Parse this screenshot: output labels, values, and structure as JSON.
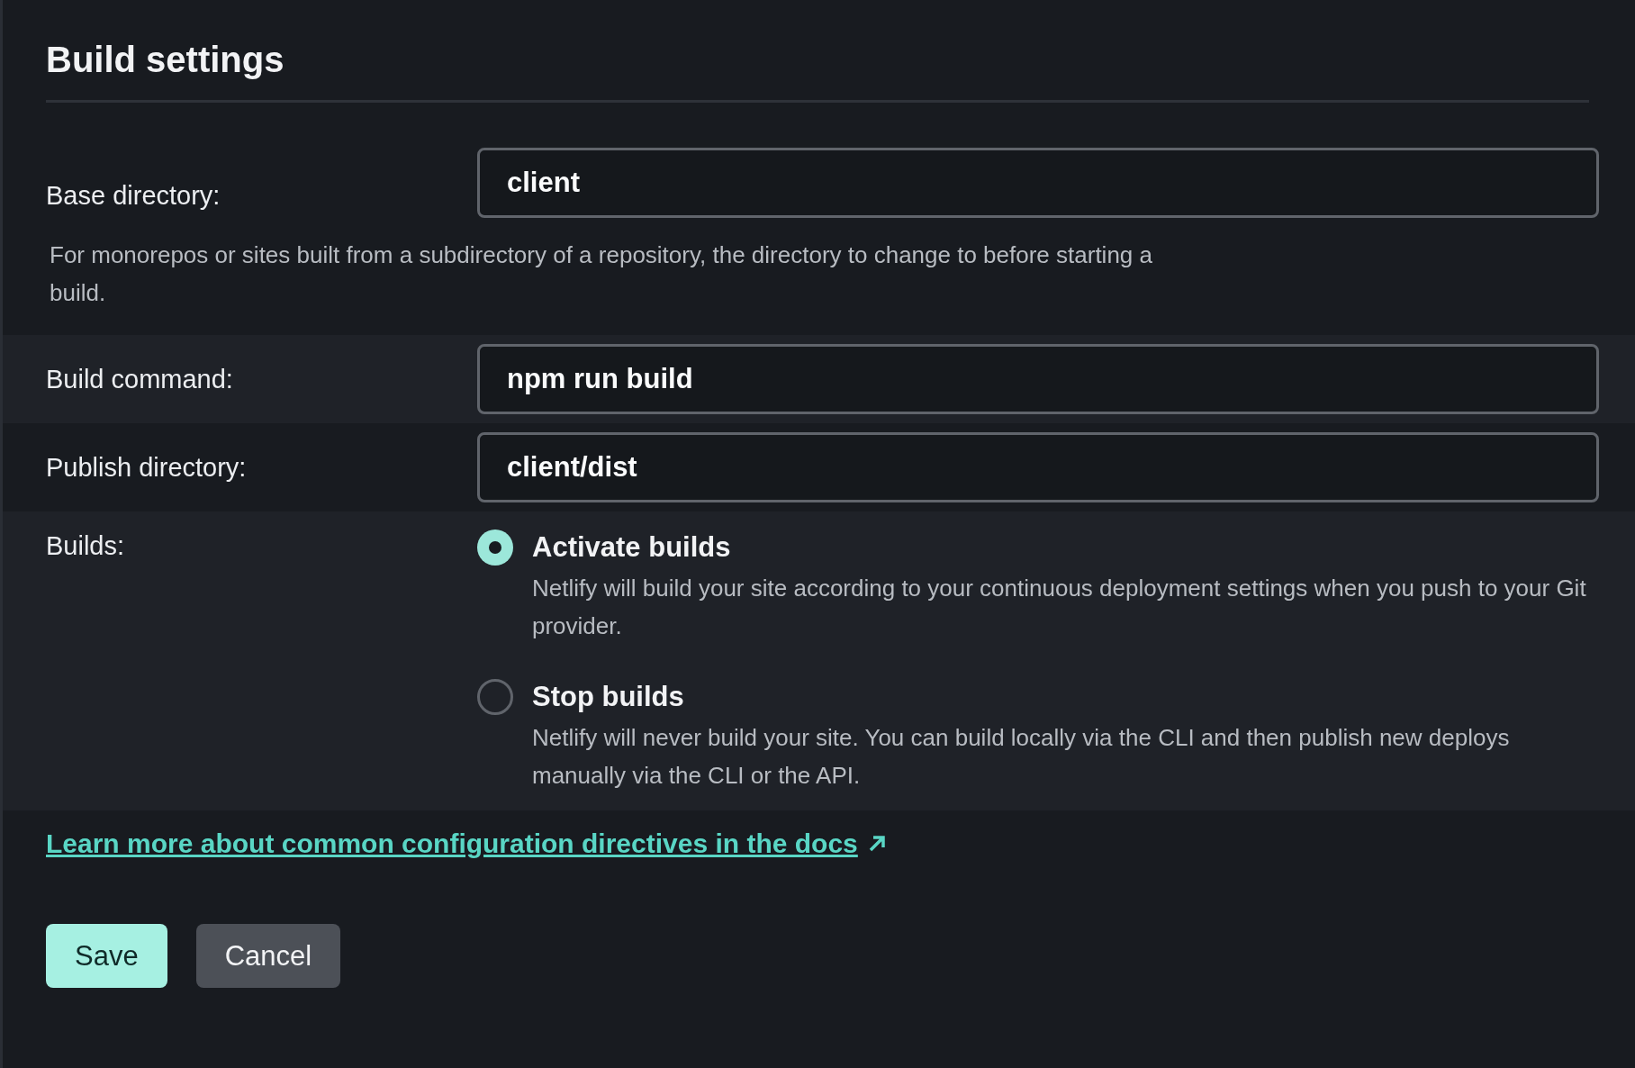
{
  "title": "Build settings",
  "fields": [
    {
      "label": "Base directory:",
      "value": "client",
      "help": "For monorepos or sites built from a subdirectory of a repository, the directory to change to before starting a build."
    },
    {
      "label": "Build command:",
      "value": "npm run build"
    },
    {
      "label": "Publish directory:",
      "value": "client/dist"
    }
  ],
  "builds": {
    "label": "Builds:",
    "options": [
      {
        "title": "Activate builds",
        "description": "Netlify will build your site according to your continuous deployment settings when you push to your Git provider.",
        "selected": true
      },
      {
        "title": "Stop builds",
        "description": "Netlify will never build your site. You can build locally via the CLI and then publish new deploys manually via the CLI or the API.",
        "selected": false
      }
    ]
  },
  "docs_link": "Learn more about common configuration directives in the docs",
  "buttons": [
    {
      "label": "Save",
      "kind": "primary"
    },
    {
      "label": "Cancel",
      "kind": "secondary"
    }
  ]
}
